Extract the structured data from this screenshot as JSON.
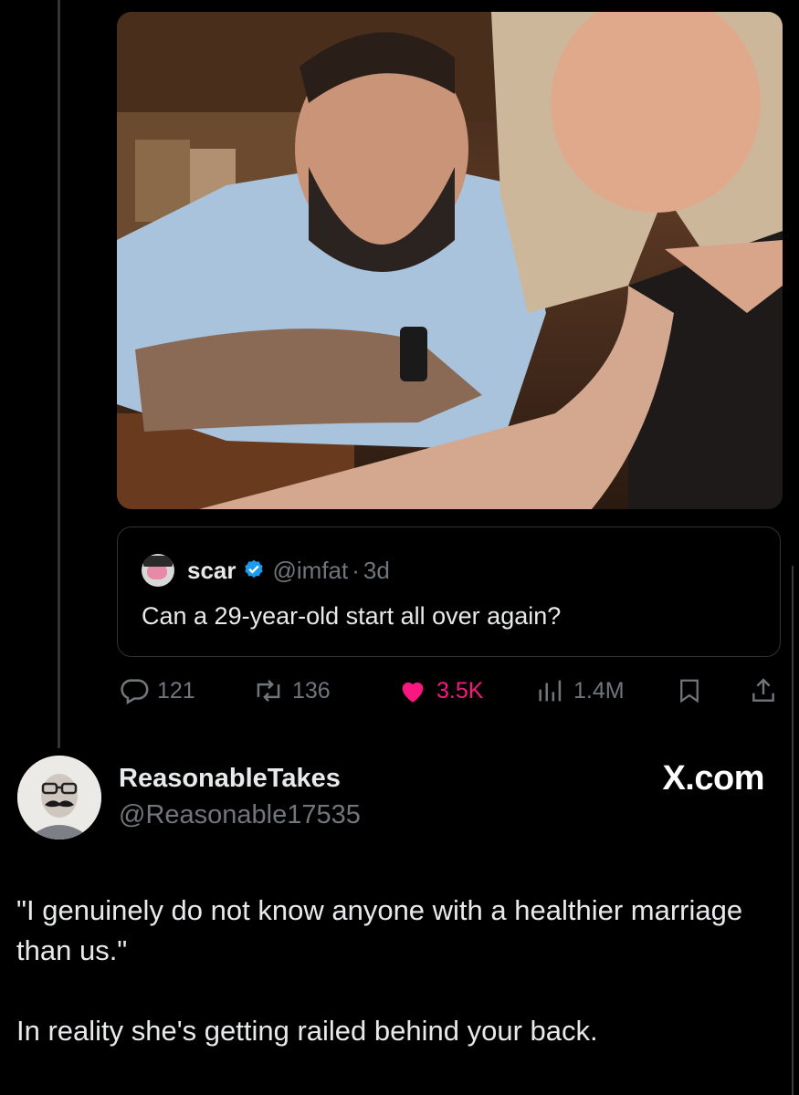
{
  "quoted_tweet": {
    "author_name": "scar",
    "author_handle": "@imfat",
    "separator": "·",
    "time": "3d",
    "text": "Can a 29-year-old start all over again?"
  },
  "actions": {
    "replies": "121",
    "reposts": "136",
    "likes": "3.5K",
    "views": "1.4M"
  },
  "post": {
    "author_name": "ReasonableTakes",
    "author_handle": "@Reasonable17535",
    "brand": "X.com",
    "paragraphs": [
      "\"I genuinely do not know anyone with a healthier marriage than us.\"",
      "In reality she's getting railed behind your back."
    ]
  },
  "colors": {
    "background": "#000000",
    "like": "#f91880",
    "verified": "#1d9bf0",
    "muted": "#71767b"
  },
  "icons": [
    "reply-icon",
    "repost-icon",
    "heart-icon",
    "views-icon",
    "bookmark-icon",
    "share-icon",
    "verified-icon"
  ]
}
